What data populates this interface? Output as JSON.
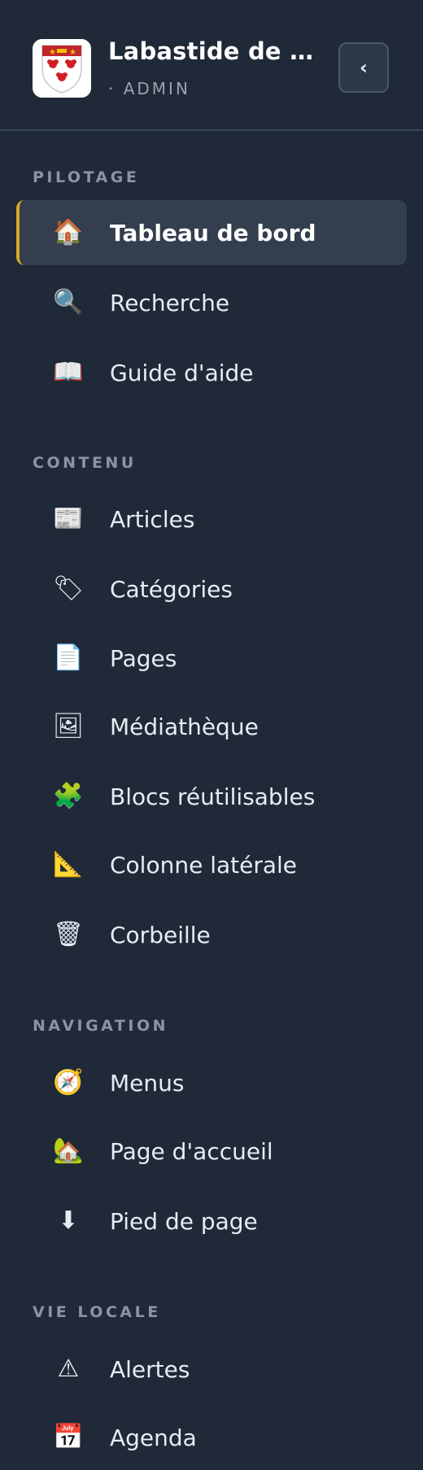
{
  "header": {
    "title": "Labastide de M...",
    "role": "· ADMIN",
    "collapse_label": "‹",
    "colors": {
      "background": "#1f2937",
      "accent": "#d4a62a"
    }
  },
  "sections": [
    {
      "label": "PILOTAGE",
      "items": [
        {
          "label": "Tableau de bord",
          "icon": "house-icon",
          "active": true
        },
        {
          "label": "Recherche",
          "icon": "magnifier-icon"
        },
        {
          "label": "Guide d'aide",
          "icon": "open-book-icon"
        }
      ]
    },
    {
      "label": "CONTENU",
      "items": [
        {
          "label": "Articles",
          "icon": "newspaper-icon"
        },
        {
          "label": "Catégories",
          "icon": "label-tag-icon"
        },
        {
          "label": "Pages",
          "icon": "page-icon"
        },
        {
          "label": "Médiathèque",
          "icon": "framed-picture-icon"
        },
        {
          "label": "Blocs réutilisables",
          "icon": "puzzle-piece-icon"
        },
        {
          "label": "Colonne latérale",
          "icon": "triangular-ruler-icon"
        },
        {
          "label": "Corbeille",
          "icon": "wastebasket-icon"
        }
      ]
    },
    {
      "label": "NAVIGATION",
      "items": [
        {
          "label": "Menus",
          "icon": "compass-icon"
        },
        {
          "label": "Page d'accueil",
          "icon": "house-with-garden-icon"
        },
        {
          "label": "Pied de page",
          "icon": "down-arrow-icon"
        }
      ]
    },
    {
      "label": "VIE LOCALE",
      "items": [
        {
          "label": "Alertes",
          "icon": "warning-icon"
        },
        {
          "label": "Agenda",
          "icon": "calendar-icon"
        }
      ]
    }
  ]
}
